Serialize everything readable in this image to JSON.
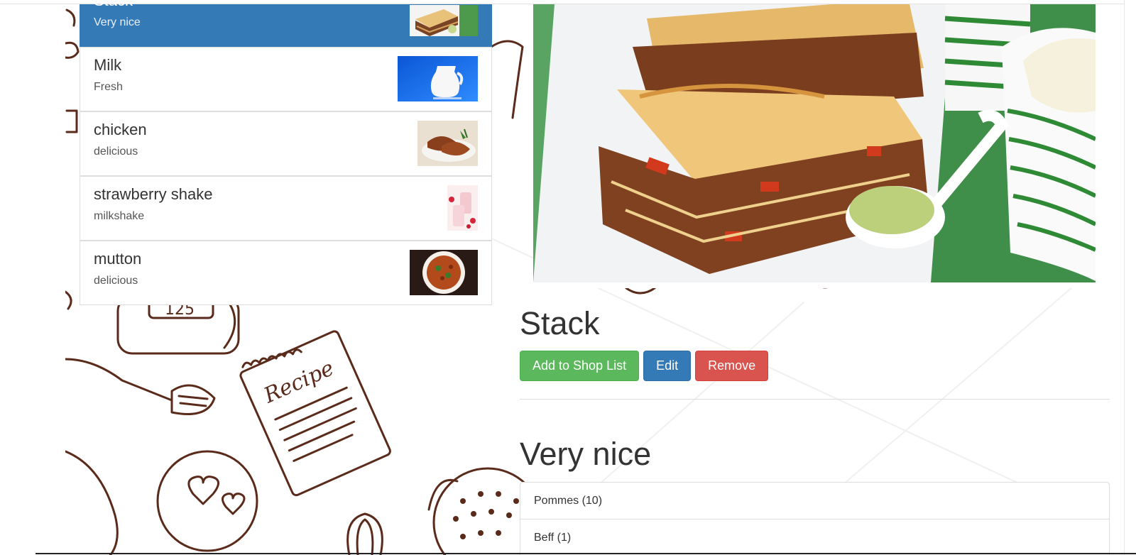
{
  "recipes": [
    {
      "name": "Stack",
      "description": "Very nice",
      "thumb": "lasagna-thumb",
      "active": true
    },
    {
      "name": "Milk",
      "description": "Fresh",
      "thumb": "milk-jug-thumb",
      "active": false
    },
    {
      "name": "chicken",
      "description": "delicious",
      "thumb": "chicken-thumb",
      "active": false
    },
    {
      "name": "strawberry shake",
      "description": "milkshake",
      "thumb": "milkshake-thumb",
      "active": false
    },
    {
      "name": "mutton",
      "description": "delicious",
      "thumb": "mutton-curry-thumb",
      "active": false
    }
  ],
  "detail": {
    "image": "lasagna-photo",
    "title": "Stack",
    "description": "Very nice",
    "buttons": {
      "add_to_shop_list": "Add to Shop List",
      "edit": "Edit",
      "remove": "Remove"
    },
    "ingredients": [
      {
        "label": "Pommes (10)"
      },
      {
        "label": "Beff (1)"
      }
    ]
  },
  "colors": {
    "active": "#337ab7",
    "success": "#5cb85c",
    "primary": "#337ab7",
    "danger": "#d9534f",
    "doodle": "#5a2a1a"
  }
}
